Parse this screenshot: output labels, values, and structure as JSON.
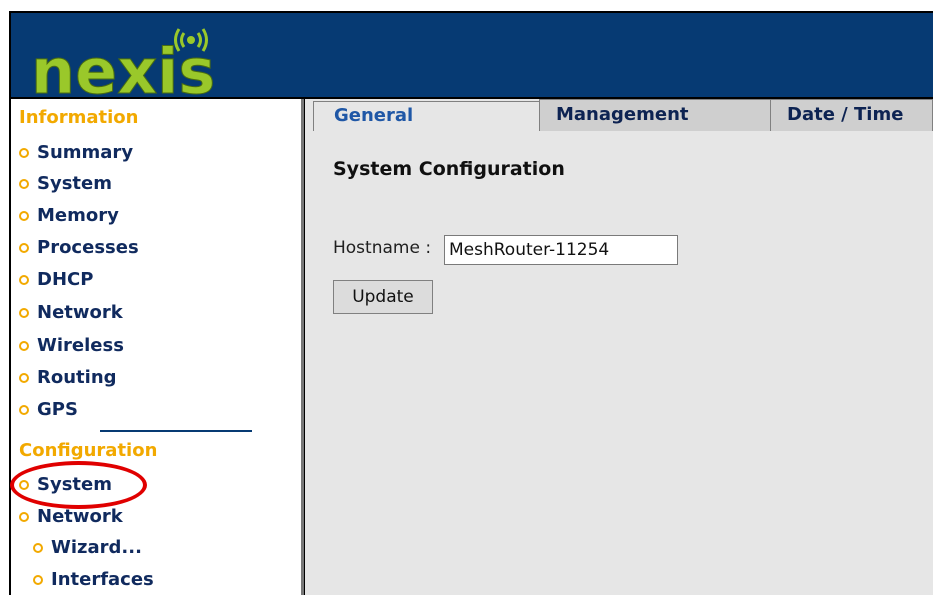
{
  "app": {
    "logo_text": "nexis",
    "logo_icon": "wireless-signal-icon"
  },
  "colors": {
    "header_bg": "#063a73",
    "logo_green": "#9ac82a",
    "section_heading": "#f2a900",
    "nav_text": "#102a5e",
    "active_tab_text": "#1f57a6",
    "highlight_ring": "#e00000"
  },
  "sidebar": {
    "information": {
      "heading": "Information",
      "items": [
        "Summary",
        "System",
        "Memory",
        "Processes",
        "DHCP",
        "Network",
        "Wireless",
        "Routing",
        "GPS"
      ]
    },
    "configuration": {
      "heading": "Configuration",
      "items": [
        "System",
        "Network"
      ],
      "sub_items": [
        "Wizard...",
        "Interfaces"
      ]
    },
    "bullet_icon": "circle-bullet-icon",
    "highlighted_item": "System"
  },
  "tabs": [
    {
      "label": "General",
      "active": true
    },
    {
      "label": "Management",
      "active": false
    },
    {
      "label": "Date / Time",
      "active": false
    }
  ],
  "panel": {
    "title": "System Configuration",
    "hostname_label": "Hostname :",
    "hostname_value": "MeshRouter-11254",
    "update_label": "Update"
  }
}
